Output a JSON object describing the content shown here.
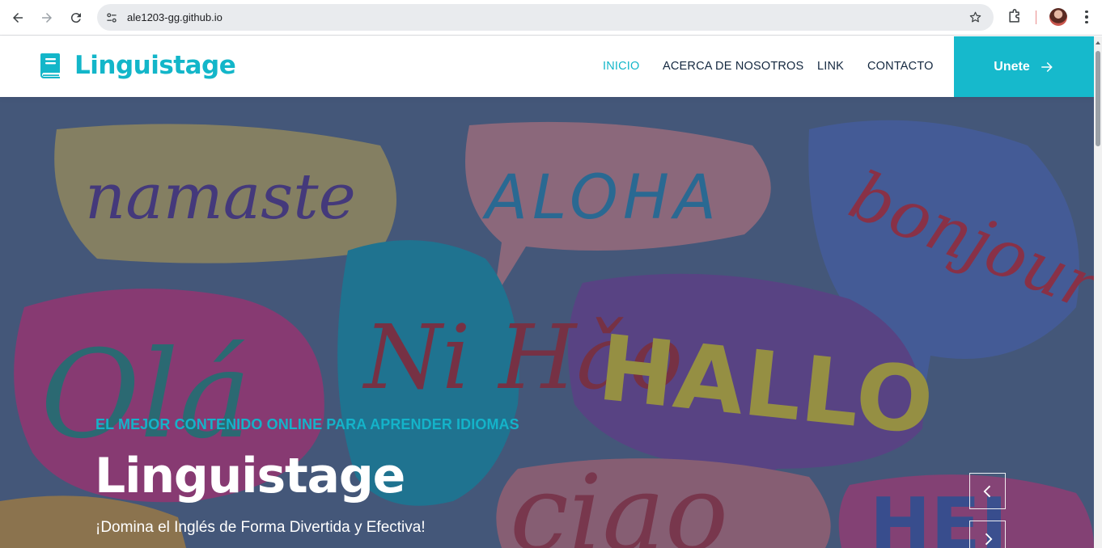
{
  "browser": {
    "url": "ale1203-gg.github.io",
    "back_icon": "arrow-left-icon",
    "forward_icon": "arrow-right-icon",
    "reload_icon": "reload-icon",
    "site_info_icon": "tune-icon",
    "bookmark_icon": "star-icon",
    "extensions_icon": "puzzle-icon",
    "menu_icon": "vertical-dots-icon"
  },
  "site": {
    "brand": {
      "name": "Linguistage",
      "icon": "book-icon"
    },
    "nav": {
      "items": [
        {
          "label": "INICIO",
          "active": true
        },
        {
          "label": "ACERCA DE NOSOTROS",
          "active": false
        },
        {
          "label": "LINK",
          "active": false
        },
        {
          "label": "CONTACTO",
          "active": false
        }
      ],
      "cta_label": "Unete",
      "cta_icon": "arrow-right-icon"
    },
    "hero": {
      "kicker": "EL MEJOR CONTENIDO ONLINE PARA APRENDER IDIOMAS",
      "title": "Linguistage",
      "subtitle": "¡Domina el Inglés de Forma Divertida y Efectiva!",
      "background_words": [
        "namaste",
        "ALOHA",
        "bonjour",
        "Olá",
        "Ni Hǎo",
        "HALLO",
        "ciao",
        "HEJ"
      ],
      "prev_icon": "chevron-left-icon",
      "next_icon": "chevron-right-icon"
    }
  },
  "colors": {
    "accent": "#16b9cc",
    "nav_text": "#13273f",
    "hero_overlay": "#26344f"
  }
}
